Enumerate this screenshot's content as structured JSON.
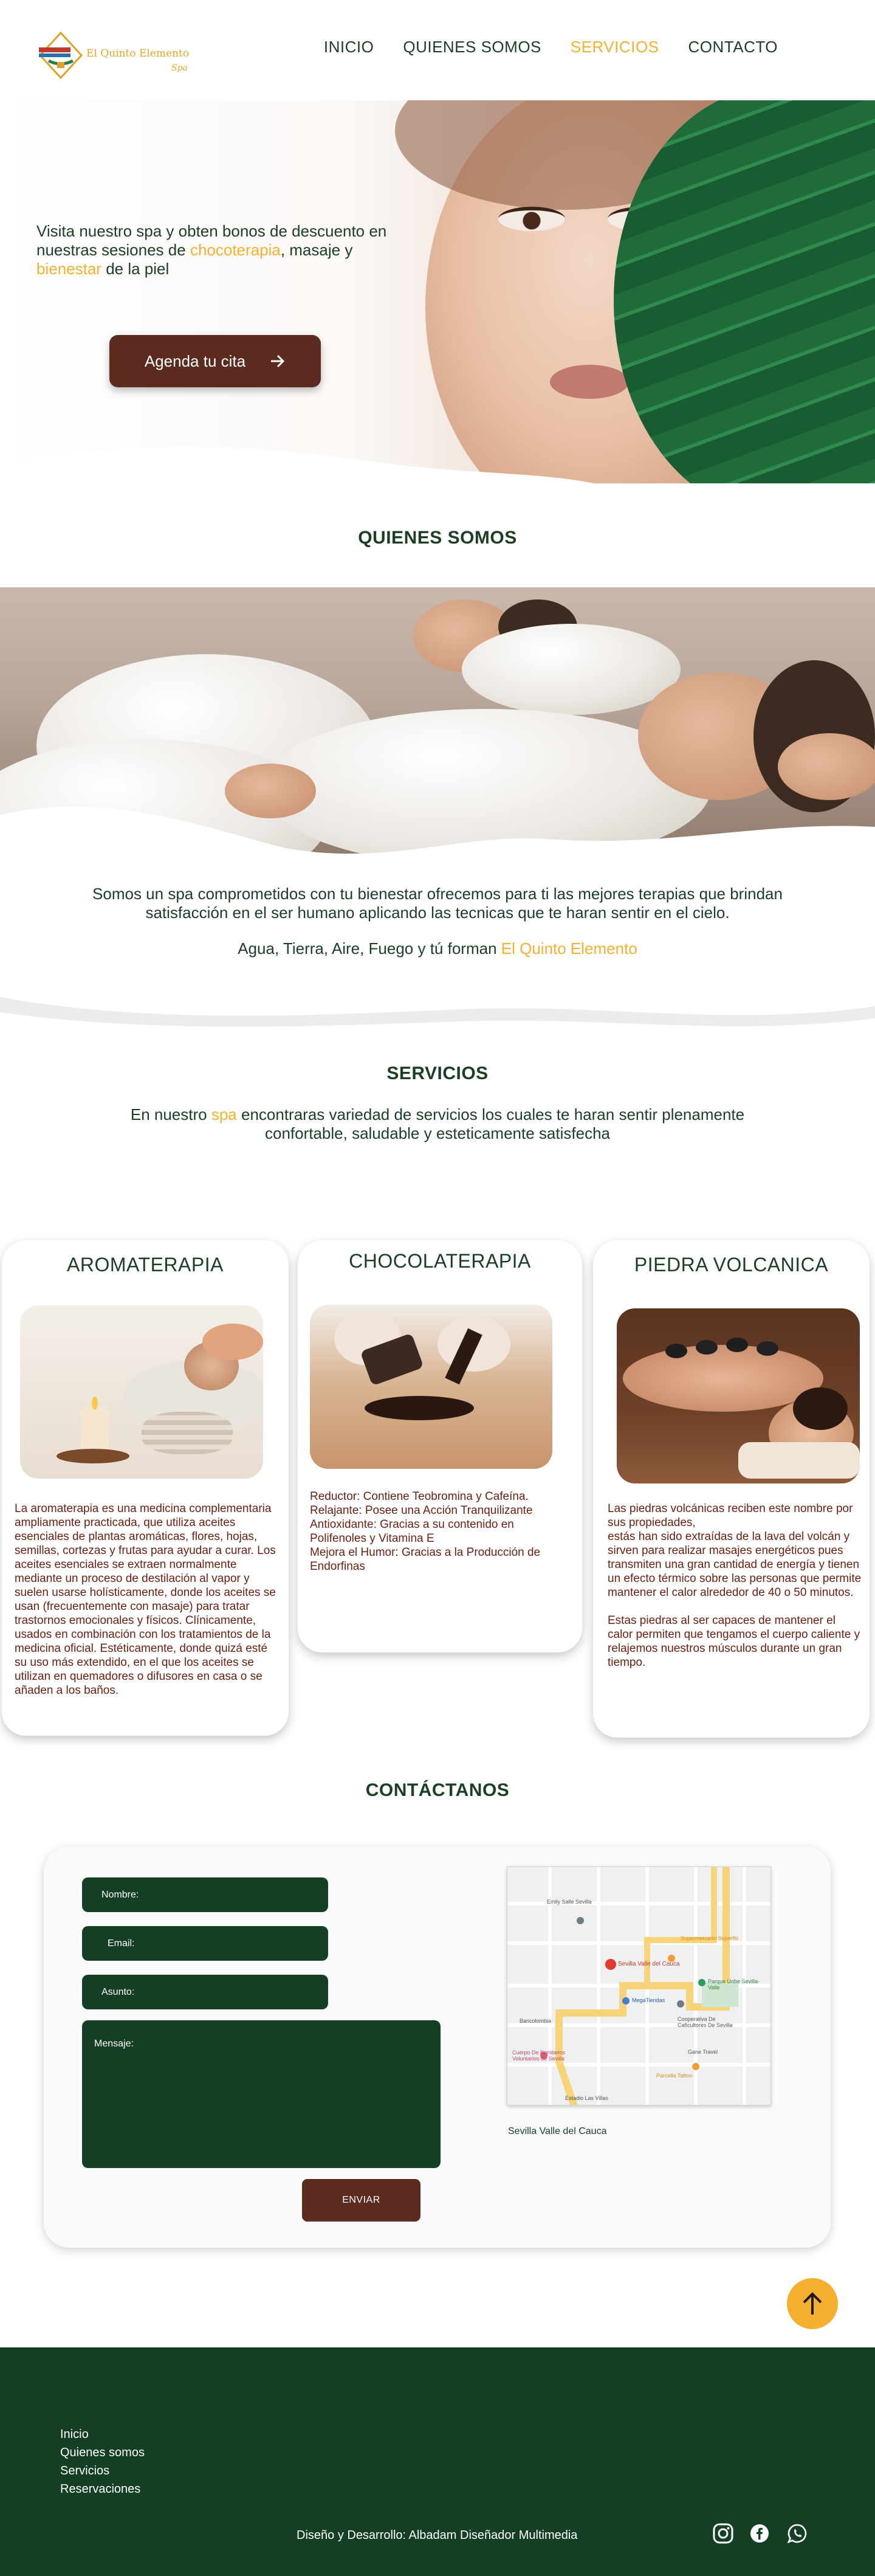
{
  "header": {
    "logo_text": "El Quinto Elemento",
    "logo_sub": "Spa",
    "nav": [
      {
        "label": "INICIO",
        "active": false
      },
      {
        "label": "QUIENES SOMOS",
        "active": false
      },
      {
        "label": "SERVICIOS",
        "active": true
      },
      {
        "label": "CONTACTO",
        "active": false
      }
    ]
  },
  "hero": {
    "text_1": "Visita nuestro spa y obten bonos de descuento en nuestras sesiones de ",
    "highlight_1": "chocoterapia",
    "text_2": ", masaje y ",
    "highlight_2": "bienestar",
    "text_3": " de la piel",
    "cta_label": "Agenda tu cita",
    "cta_icon": "arrow-right-icon"
  },
  "quienes": {
    "title": "QUIENES SOMOS",
    "paragraph": "Somos un spa comprometidos con tu bienestar ofrecemos para ti las mejores terapias que brindan satisfacción en el ser humano aplicando las tecnicas que te haran sentir en el cielo.",
    "sub_text": "Agua, Tierra, Aire, Fuego y tú forman ",
    "sub_highlight": "El Quinto Elemento"
  },
  "servicios": {
    "title": "SERVICIOS",
    "intro_1": "En nuestro ",
    "intro_highlight": "spa",
    "intro_2": " encontraras variedad de servicios los cuales te haran sentir plenamente confortable, saludable y esteticamente satisfecha",
    "cards": [
      {
        "title": "AROMATERAPIA",
        "text": "La aromaterapia es una medicina complementaria ampliamente practicada, que utiliza aceites esenciales de plantas aromáticas, flores, hojas, semillas, cortezas y frutas para ayudar a curar. Los aceites esenciales se extraen normalmente mediante un proceso de destilación al vapor y suelen usarse holísticamente, donde los aceites se usan (frecuentemente con masaje) para tratar trastornos emocionales y físicos. Clínicamente, usados en combinación con los tratamientos de la medicina oficial. Estéticamente, donde quizá esté su uso más extendido, en el que los aceites se utilizan en quemadores o difusores en casa o se añaden a los baños."
      },
      {
        "title": "CHOCOLATERAPIA",
        "text": "Reductor: Contiene Teobromina y Cafeína.\nRelajante: Posee una Acción Tranquilizante\nAntioxidante: Gracias a su contenido en Polifenoles y Vitamina E\nMejora el Humor: Gracias a la Producción de Endorfinas"
      },
      {
        "title": "PIEDRA VOLCANICA",
        "text": "Las piedras volcánicas reciben este nombre por sus propiedades,\nestás han sido extraídas de la lava del volcán y sirven para realizar masajes energéticos pues transmiten una gran cantidad de energía y tienen un efecto térmico sobre las personas que permite mantener el calor alrededor de 40 o 50 minutos.\n\nEstas piedras al ser capaces de mantener el calor permiten que tengamos el cuerpo caliente y relajemos nuestros músculos durante un gran tiempo."
      }
    ]
  },
  "contacto": {
    "title": "CONTÁCTANOS",
    "fields": {
      "nombre": "Nombre:",
      "email": "Email:",
      "asunto": "Asunto:",
      "mensaje": "Mensaje:"
    },
    "send_label": "ENVIAR",
    "map_caption": "Sevilla Valle del Cauca",
    "map_labels": [
      "Sevilla Valle del Cauca",
      "Parque Uribe Sevilla- Valle",
      "Cooperativa De Caficultores De Sevilla",
      "Cuerpo De Bomberos Voluntarios de Sevilla",
      "Bancolombia",
      "Gane Travel",
      "Supermercado Superflo",
      "MegaTiendas",
      "Emily Salle Sevilla",
      "Parcella Tattoo",
      "Estadio Las Villas"
    ]
  },
  "footer": {
    "links": [
      "Inicio",
      "Quienes somos",
      "Servicios",
      "Reservaciones"
    ],
    "credit": "Diseño y Desarrollo: Albadam Diseñador Multimedia",
    "social": [
      "instagram-icon",
      "facebook-icon",
      "whatsapp-icon"
    ]
  },
  "colors": {
    "primary_green": "#153f24",
    "accent_yellow": "#f5b030",
    "brown": "#5b2b20",
    "card_text": "#6b1f12"
  }
}
